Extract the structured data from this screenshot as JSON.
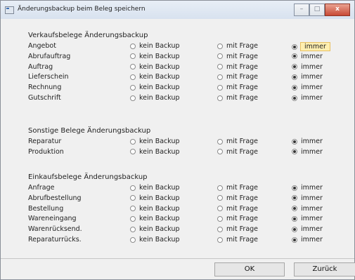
{
  "window": {
    "title": "Änderungsbackup beim Beleg speichern",
    "controls": {
      "minimize": "–",
      "maximize": "□",
      "close": "x"
    }
  },
  "options": {
    "kein": "kein Backup",
    "frage": "mit Frage",
    "immer": "immer"
  },
  "sections": [
    {
      "title": "Verkaufsbelege  Änderungsbackup",
      "rows": [
        {
          "label": "Angebot",
          "selected": "immer",
          "focused": true
        },
        {
          "label": "Abrufauftrag",
          "selected": "immer"
        },
        {
          "label": "Auftrag",
          "selected": "immer"
        },
        {
          "label": "Lieferschein",
          "selected": "immer"
        },
        {
          "label": "Rechnung",
          "selected": "immer"
        },
        {
          "label": "Gutschrift",
          "selected": "immer"
        }
      ]
    },
    {
      "title": "Sonstige Belege  Änderungsbackup",
      "rows": [
        {
          "label": "Reparatur",
          "selected": "immer"
        },
        {
          "label": "Produktion",
          "selected": "immer"
        }
      ]
    },
    {
      "title": "Einkaufsbelege  Änderungsbackup",
      "rows": [
        {
          "label": "Anfrage",
          "selected": "immer"
        },
        {
          "label": "Abrufbestellung",
          "selected": "immer"
        },
        {
          "label": "Bestellung",
          "selected": "immer"
        },
        {
          "label": "Wareneingang",
          "selected": "immer"
        },
        {
          "label": "Warenrücksend.",
          "selected": "immer"
        },
        {
          "label": "Reparaturrücks.",
          "selected": "immer"
        }
      ]
    }
  ],
  "buttons": {
    "ok": "OK",
    "back": "Zurück"
  }
}
